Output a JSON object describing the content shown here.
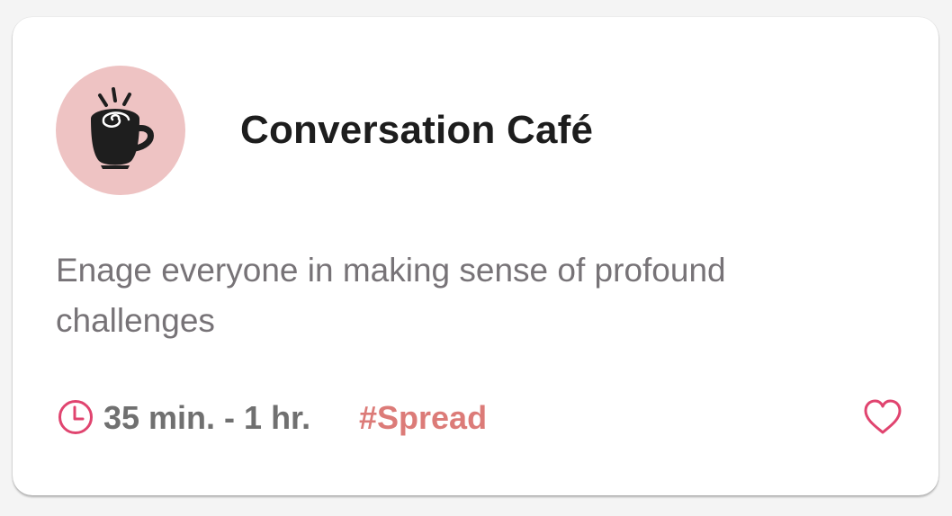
{
  "card": {
    "icon": "coffee-cup-icon",
    "title": "Conversation Café",
    "description": "Enage everyone in making sense of profound challenges",
    "duration": "35 min. - 1 hr.",
    "tag": "#Spread",
    "duration_icon": "clock-icon",
    "favorite_icon": "heart-icon"
  },
  "colors": {
    "avatar_background": "#eec3c3",
    "accent": "#e0446f",
    "tag": "#dc7b78",
    "title": "#1d1d1d",
    "description": "#777377"
  }
}
